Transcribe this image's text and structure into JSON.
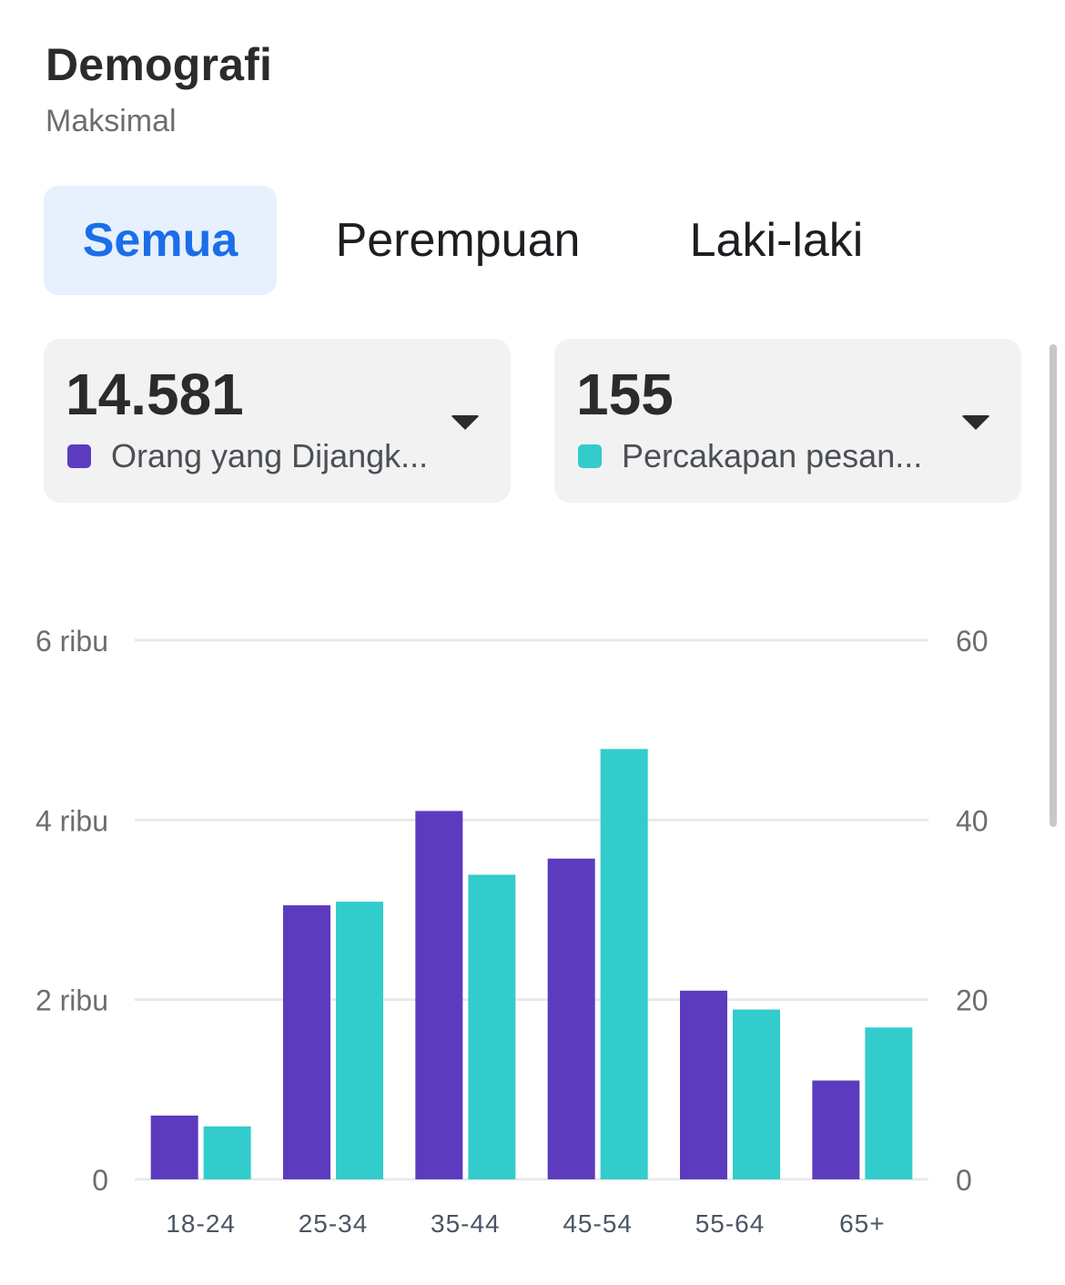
{
  "header": {
    "title": "Demografi",
    "subtitle": "Maksimal"
  },
  "tabs": [
    {
      "label": "Semua",
      "active": true
    },
    {
      "label": "Perempuan",
      "active": false
    },
    {
      "label": "Laki-laki",
      "active": false
    }
  ],
  "metrics": [
    {
      "value": "14.581",
      "label": "Orang yang Dijangk...",
      "color": "#5c3bbf"
    },
    {
      "value": "155",
      "label": "Percakapan pesan...",
      "color": "#33cccc"
    }
  ],
  "chart_data": {
    "type": "bar",
    "categories": [
      "18-24",
      "25-34",
      "35-44",
      "45-54",
      "55-64",
      "65+"
    ],
    "series": [
      {
        "name": "Orang yang Dijangk...",
        "axis": "left",
        "color": "#5c3bbf",
        "values": [
          710,
          3050,
          4100,
          3570,
          2100,
          1100
        ]
      },
      {
        "name": "Percakapan pesan...",
        "axis": "right",
        "color": "#33cccc",
        "values": [
          5.9,
          30.9,
          33.9,
          47.9,
          18.9,
          16.9
        ]
      }
    ],
    "y_left": {
      "min": 0,
      "max": 6000,
      "ticks": [
        0,
        2000,
        4000,
        6000
      ],
      "tick_labels": [
        "0",
        "2 ribu",
        "4 ribu",
        "6 ribu"
      ]
    },
    "y_right": {
      "min": 0,
      "max": 60,
      "ticks": [
        0,
        20,
        40,
        60
      ],
      "tick_labels": [
        "0",
        "20",
        "40",
        "60"
      ]
    },
    "grid": true
  }
}
